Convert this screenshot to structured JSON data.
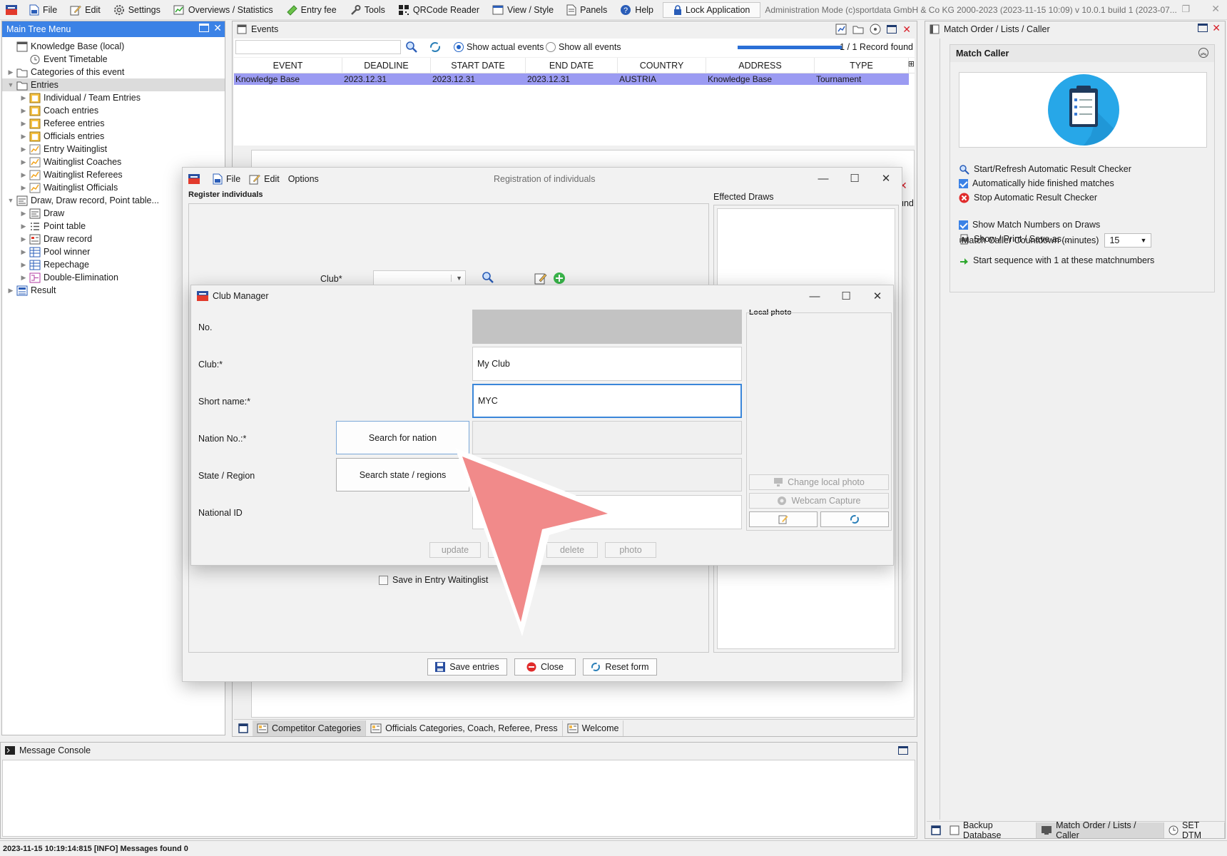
{
  "menubar": {
    "items": [
      {
        "label": "File",
        "icon": "file-icon"
      },
      {
        "label": "Edit",
        "icon": "edit-icon"
      },
      {
        "label": "Settings",
        "icon": "gear-icon"
      },
      {
        "label": "Overviews / Statistics",
        "icon": "statistics-icon"
      },
      {
        "label": "Entry fee",
        "icon": "money-icon"
      },
      {
        "label": "Tools",
        "icon": "wrench-icon"
      },
      {
        "label": "QRCode Reader",
        "icon": "qrcode-icon"
      },
      {
        "label": "View / Style",
        "icon": "view-icon"
      },
      {
        "label": "Panels",
        "icon": "panels-icon"
      },
      {
        "label": "Help",
        "icon": "help-icon"
      }
    ],
    "lock_label": "Lock Application",
    "admin_text": "Administration Mode (c)sportdata GmbH & Co KG 2000-2023 (2023-11-15 10:09)  v 10.0.1 build 1 (2023-07..."
  },
  "tree": {
    "title": "Main Tree Menu",
    "items": [
      {
        "label": "Knowledge Base (local)",
        "level": 0,
        "toggle": "",
        "icon": "database-icon"
      },
      {
        "label": "Event Timetable",
        "level": 1,
        "toggle": "",
        "icon": "clock-icon"
      },
      {
        "label": "Categories of this event",
        "level": 0,
        "toggle": "▶",
        "icon": "folder-icon"
      },
      {
        "label": "Entries",
        "level": 0,
        "toggle": "▼",
        "icon": "folder-icon",
        "selected": true
      },
      {
        "label": "Individual / Team Entries",
        "level": 1,
        "toggle": "▶",
        "icon": "entries-icon"
      },
      {
        "label": "Coach entries",
        "level": 1,
        "toggle": "▶",
        "icon": "entries-icon"
      },
      {
        "label": "Referee entries",
        "level": 1,
        "toggle": "▶",
        "icon": "entries-icon"
      },
      {
        "label": "Officials entries",
        "level": 1,
        "toggle": "▶",
        "icon": "entries-icon"
      },
      {
        "label": "Entry Waitinglist",
        "level": 1,
        "toggle": "▶",
        "icon": "waitinglist-icon"
      },
      {
        "label": "Waitinglist Coaches",
        "level": 1,
        "toggle": "▶",
        "icon": "waitinglist-icon"
      },
      {
        "label": "Waitinglist Referees",
        "level": 1,
        "toggle": "▶",
        "icon": "waitinglist-icon"
      },
      {
        "label": "Waitinglist Officials",
        "level": 1,
        "toggle": "▶",
        "icon": "waitinglist-icon"
      },
      {
        "label": "Draw, Draw record, Point table...",
        "level": 0,
        "toggle": "▼",
        "icon": "draw-icon"
      },
      {
        "label": "Draw",
        "level": 1,
        "toggle": "▶",
        "icon": "draw-icon"
      },
      {
        "label": "Point table",
        "level": 1,
        "toggle": "▶",
        "icon": "list-icon"
      },
      {
        "label": "Draw record",
        "level": 1,
        "toggle": "▶",
        "icon": "record-icon"
      },
      {
        "label": "Pool winner",
        "level": 1,
        "toggle": "▶",
        "icon": "table-icon"
      },
      {
        "label": "Repechage",
        "level": 1,
        "toggle": "▶",
        "icon": "table-icon"
      },
      {
        "label": "Double-Elimination",
        "level": 1,
        "toggle": "▶",
        "icon": "bracket-icon"
      },
      {
        "label": "Result",
        "level": 0,
        "toggle": "▶",
        "icon": "result-icon"
      }
    ]
  },
  "events": {
    "title": "Events",
    "search_value": "",
    "radio_actual": "Show actual events",
    "radio_all": "Show all events",
    "record_count": "1 / 1 Record found",
    "progress_pct": 100,
    "columns": [
      "EVENT",
      "DEADLINE",
      "START DATE",
      "END DATE",
      "COUNTRY",
      "ADDRESS",
      "TYPE"
    ],
    "rows": [
      [
        "Knowledge Base",
        "2023.12.31",
        "2023.12.31",
        "2023.12.31",
        "AUSTRIA",
        "Knowledge Base",
        "Tournament"
      ]
    ],
    "partial_right_text": "und"
  },
  "bottom_tabs": [
    {
      "label": "Competitor Categories",
      "active": true
    },
    {
      "label": "Officials Categories, Coach, Referee, Press",
      "active": false
    },
    {
      "label": "Welcome",
      "active": false
    }
  ],
  "console": {
    "title": "Message Console",
    "status": "2023-11-15 10:19:14:815 [INFO] Messages found 0"
  },
  "right_panel": {
    "title": "Match Order / Lists / Caller",
    "section_title": "Match Caller",
    "items": [
      {
        "label": "Start/Refresh Automatic Result Checker",
        "kind": "icon",
        "icon": "magnifier-refresh-icon"
      },
      {
        "label": "Automatically hide finished matches",
        "kind": "checkbox",
        "checked": true
      },
      {
        "label": "Stop Automatic Result Checker",
        "kind": "icon",
        "icon": "stop-icon"
      },
      {
        "label": "Show Match Numbers on Draws",
        "kind": "checkbox",
        "checked": true
      },
      {
        "label": "Show / Print / Save as...",
        "kind": "icon",
        "icon": "print-icon"
      }
    ],
    "countdown_label": "Match Caller Countdown (minutes)",
    "countdown_value": "15",
    "sequence_label": "Start sequence with 1 at these matchnumbers",
    "tabs": [
      "Backup Database",
      "Match Order / Lists / Caller",
      "SET DTM"
    ]
  },
  "registration": {
    "title": "Registration of individuals",
    "menu": [
      "File",
      "Edit",
      "Options"
    ],
    "group_label": "Register individuals",
    "club_label": "Club*",
    "club_value": "",
    "effected_draws": "Effected Draws",
    "waitinglist_label": "Save in Entry Waitinglist",
    "buttons": {
      "save": "Save entries",
      "close": "Close",
      "reset": "Reset form"
    }
  },
  "club_manager": {
    "title": "Club Manager",
    "fields": {
      "no_label": "No.",
      "no_value": "",
      "club_label": "Club:*",
      "club_value": "My Club",
      "short_label": "Short name:*",
      "short_value": "MYC",
      "nation_label": "Nation No.:*",
      "nation_button": "Search for nation",
      "nation_value": "",
      "state_label": "State / Region",
      "state_button": "Search state / regions",
      "state_value": "",
      "national_id_label": "National ID",
      "national_id_value": ""
    },
    "photo_label": "Local photo",
    "change_photo": "Change local photo",
    "webcam": "Webcam Capture",
    "actions": [
      "update",
      "save",
      "delete",
      "photo"
    ]
  },
  "colors": {
    "accent": "#3b82e6",
    "selected_row": "#9b9bf2",
    "pointer": "#f08080"
  }
}
